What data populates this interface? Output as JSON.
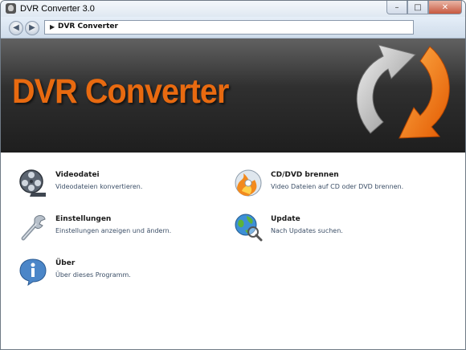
{
  "window": {
    "title": "DVR Converter 3.0"
  },
  "window_buttons": {
    "minimize": "–",
    "maximize": "□",
    "close": "✕"
  },
  "nav": {
    "back": "◀",
    "forward": "▶",
    "breadcrumb_arrow": "▶",
    "breadcrumb": "DVR Converter"
  },
  "banner": {
    "title": "DVR Converter"
  },
  "menu": [
    {
      "title": "Videodatei",
      "desc": "Videodateien konvertieren.",
      "icon": "film-reel-icon"
    },
    {
      "title": "CD/DVD brennen",
      "desc": "Video Dateien auf CD oder DVD brennen.",
      "icon": "burn-disc-icon"
    },
    {
      "title": "Einstellungen",
      "desc": "Einstellungen anzeigen und ändern.",
      "icon": "wrench-icon"
    },
    {
      "title": "Update",
      "desc": "Nach Updates suchen.",
      "icon": "globe-search-icon"
    },
    {
      "title": "Über",
      "desc": "Über dieses Programm.",
      "icon": "info-icon"
    }
  ],
  "colors": {
    "banner_text": "#e86a10",
    "desc_text": "#3c4f67"
  }
}
